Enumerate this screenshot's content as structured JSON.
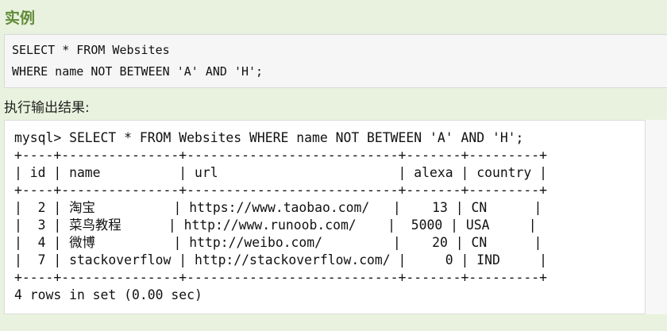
{
  "heading": "实例",
  "example_code": {
    "line1": "SELECT * FROM Websites",
    "line2": "WHERE name NOT BETWEEN 'A' AND 'H';"
  },
  "output_label": "执行输出结果:",
  "terminal": {
    "command": "mysql> SELECT * FROM Websites WHERE name NOT BETWEEN 'A' AND 'H';",
    "border_top": "+----+---------------+---------------------------+-------+---------+",
    "header": "| id | name          | url                       | alexa | country |",
    "border_mid": "+----+---------------+---------------------------+-------+---------+",
    "rows": [
      "|  2 | 淘宝          | https://www.taobao.com/   |    13 | CN      |",
      "|  3 | 菜鸟教程      | http://www.runoob.com/    |  5000 | USA     |",
      "|  4 | 微博          | http://weibo.com/         |    20 | CN      |",
      "|  7 | stackoverflow | http://stackoverflow.com/ |     0 | IND     |"
    ],
    "border_bottom": "+----+---------------+---------------------------+-------+---------+",
    "summary": "4 rows in set (0.00 sec)"
  }
}
